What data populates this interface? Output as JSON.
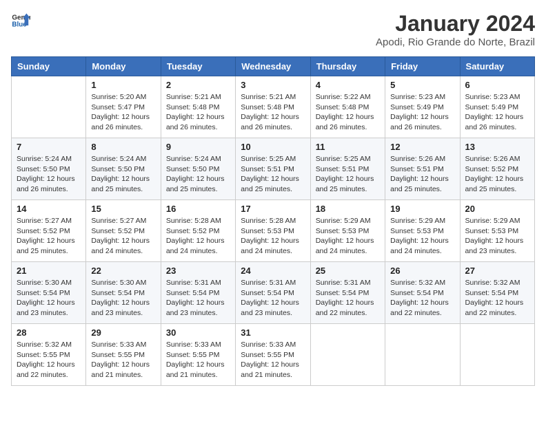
{
  "header": {
    "logo_line1": "General",
    "logo_line2": "Blue",
    "month": "January 2024",
    "location": "Apodi, Rio Grande do Norte, Brazil"
  },
  "days_of_week": [
    "Sunday",
    "Monday",
    "Tuesday",
    "Wednesday",
    "Thursday",
    "Friday",
    "Saturday"
  ],
  "weeks": [
    [
      {
        "day": "",
        "info": ""
      },
      {
        "day": "1",
        "info": "Sunrise: 5:20 AM\nSunset: 5:47 PM\nDaylight: 12 hours\nand 26 minutes."
      },
      {
        "day": "2",
        "info": "Sunrise: 5:21 AM\nSunset: 5:48 PM\nDaylight: 12 hours\nand 26 minutes."
      },
      {
        "day": "3",
        "info": "Sunrise: 5:21 AM\nSunset: 5:48 PM\nDaylight: 12 hours\nand 26 minutes."
      },
      {
        "day": "4",
        "info": "Sunrise: 5:22 AM\nSunset: 5:48 PM\nDaylight: 12 hours\nand 26 minutes."
      },
      {
        "day": "5",
        "info": "Sunrise: 5:23 AM\nSunset: 5:49 PM\nDaylight: 12 hours\nand 26 minutes."
      },
      {
        "day": "6",
        "info": "Sunrise: 5:23 AM\nSunset: 5:49 PM\nDaylight: 12 hours\nand 26 minutes."
      }
    ],
    [
      {
        "day": "7",
        "info": "Sunrise: 5:24 AM\nSunset: 5:50 PM\nDaylight: 12 hours\nand 26 minutes."
      },
      {
        "day": "8",
        "info": "Sunrise: 5:24 AM\nSunset: 5:50 PM\nDaylight: 12 hours\nand 25 minutes."
      },
      {
        "day": "9",
        "info": "Sunrise: 5:24 AM\nSunset: 5:50 PM\nDaylight: 12 hours\nand 25 minutes."
      },
      {
        "day": "10",
        "info": "Sunrise: 5:25 AM\nSunset: 5:51 PM\nDaylight: 12 hours\nand 25 minutes."
      },
      {
        "day": "11",
        "info": "Sunrise: 5:25 AM\nSunset: 5:51 PM\nDaylight: 12 hours\nand 25 minutes."
      },
      {
        "day": "12",
        "info": "Sunrise: 5:26 AM\nSunset: 5:51 PM\nDaylight: 12 hours\nand 25 minutes."
      },
      {
        "day": "13",
        "info": "Sunrise: 5:26 AM\nSunset: 5:52 PM\nDaylight: 12 hours\nand 25 minutes."
      }
    ],
    [
      {
        "day": "14",
        "info": "Sunrise: 5:27 AM\nSunset: 5:52 PM\nDaylight: 12 hours\nand 25 minutes."
      },
      {
        "day": "15",
        "info": "Sunrise: 5:27 AM\nSunset: 5:52 PM\nDaylight: 12 hours\nand 24 minutes."
      },
      {
        "day": "16",
        "info": "Sunrise: 5:28 AM\nSunset: 5:52 PM\nDaylight: 12 hours\nand 24 minutes."
      },
      {
        "day": "17",
        "info": "Sunrise: 5:28 AM\nSunset: 5:53 PM\nDaylight: 12 hours\nand 24 minutes."
      },
      {
        "day": "18",
        "info": "Sunrise: 5:29 AM\nSunset: 5:53 PM\nDaylight: 12 hours\nand 24 minutes."
      },
      {
        "day": "19",
        "info": "Sunrise: 5:29 AM\nSunset: 5:53 PM\nDaylight: 12 hours\nand 24 minutes."
      },
      {
        "day": "20",
        "info": "Sunrise: 5:29 AM\nSunset: 5:53 PM\nDaylight: 12 hours\nand 23 minutes."
      }
    ],
    [
      {
        "day": "21",
        "info": "Sunrise: 5:30 AM\nSunset: 5:54 PM\nDaylight: 12 hours\nand 23 minutes."
      },
      {
        "day": "22",
        "info": "Sunrise: 5:30 AM\nSunset: 5:54 PM\nDaylight: 12 hours\nand 23 minutes."
      },
      {
        "day": "23",
        "info": "Sunrise: 5:31 AM\nSunset: 5:54 PM\nDaylight: 12 hours\nand 23 minutes."
      },
      {
        "day": "24",
        "info": "Sunrise: 5:31 AM\nSunset: 5:54 PM\nDaylight: 12 hours\nand 23 minutes."
      },
      {
        "day": "25",
        "info": "Sunrise: 5:31 AM\nSunset: 5:54 PM\nDaylight: 12 hours\nand 22 minutes."
      },
      {
        "day": "26",
        "info": "Sunrise: 5:32 AM\nSunset: 5:54 PM\nDaylight: 12 hours\nand 22 minutes."
      },
      {
        "day": "27",
        "info": "Sunrise: 5:32 AM\nSunset: 5:54 PM\nDaylight: 12 hours\nand 22 minutes."
      }
    ],
    [
      {
        "day": "28",
        "info": "Sunrise: 5:32 AM\nSunset: 5:55 PM\nDaylight: 12 hours\nand 22 minutes."
      },
      {
        "day": "29",
        "info": "Sunrise: 5:33 AM\nSunset: 5:55 PM\nDaylight: 12 hours\nand 21 minutes."
      },
      {
        "day": "30",
        "info": "Sunrise: 5:33 AM\nSunset: 5:55 PM\nDaylight: 12 hours\nand 21 minutes."
      },
      {
        "day": "31",
        "info": "Sunrise: 5:33 AM\nSunset: 5:55 PM\nDaylight: 12 hours\nand 21 minutes."
      },
      {
        "day": "",
        "info": ""
      },
      {
        "day": "",
        "info": ""
      },
      {
        "day": "",
        "info": ""
      }
    ]
  ]
}
